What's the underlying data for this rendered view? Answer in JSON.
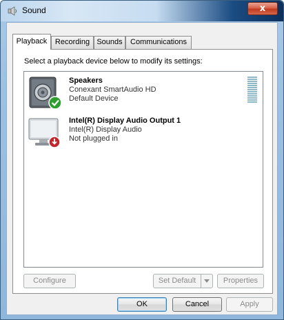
{
  "window": {
    "title": "Sound",
    "close_label": "x"
  },
  "tabs": [
    {
      "label": "Playback",
      "active": true
    },
    {
      "label": "Recording",
      "active": false
    },
    {
      "label": "Sounds",
      "active": false
    },
    {
      "label": "Communications",
      "active": false
    }
  ],
  "instruction": "Select a playback device below to modify its settings:",
  "devices": [
    {
      "name": "Speakers",
      "line1": "Conexant SmartAudio HD",
      "line2": "Default Device",
      "icon": "speakers-icon",
      "status_icon": "default-check-icon",
      "status_color": "#2e9e2e"
    },
    {
      "name": "Intel(R) Display Audio Output 1",
      "line1": "Intel(R) Display Audio",
      "line2": "Not plugged in",
      "icon": "monitor-icon",
      "status_icon": "unplugged-icon",
      "status_color": "#c0282d"
    }
  ],
  "panel_buttons": {
    "configure": "Configure",
    "set_default": "Set Default",
    "properties": "Properties"
  },
  "dialog_buttons": {
    "ok": "OK",
    "cancel": "Cancel",
    "apply": "Apply"
  }
}
